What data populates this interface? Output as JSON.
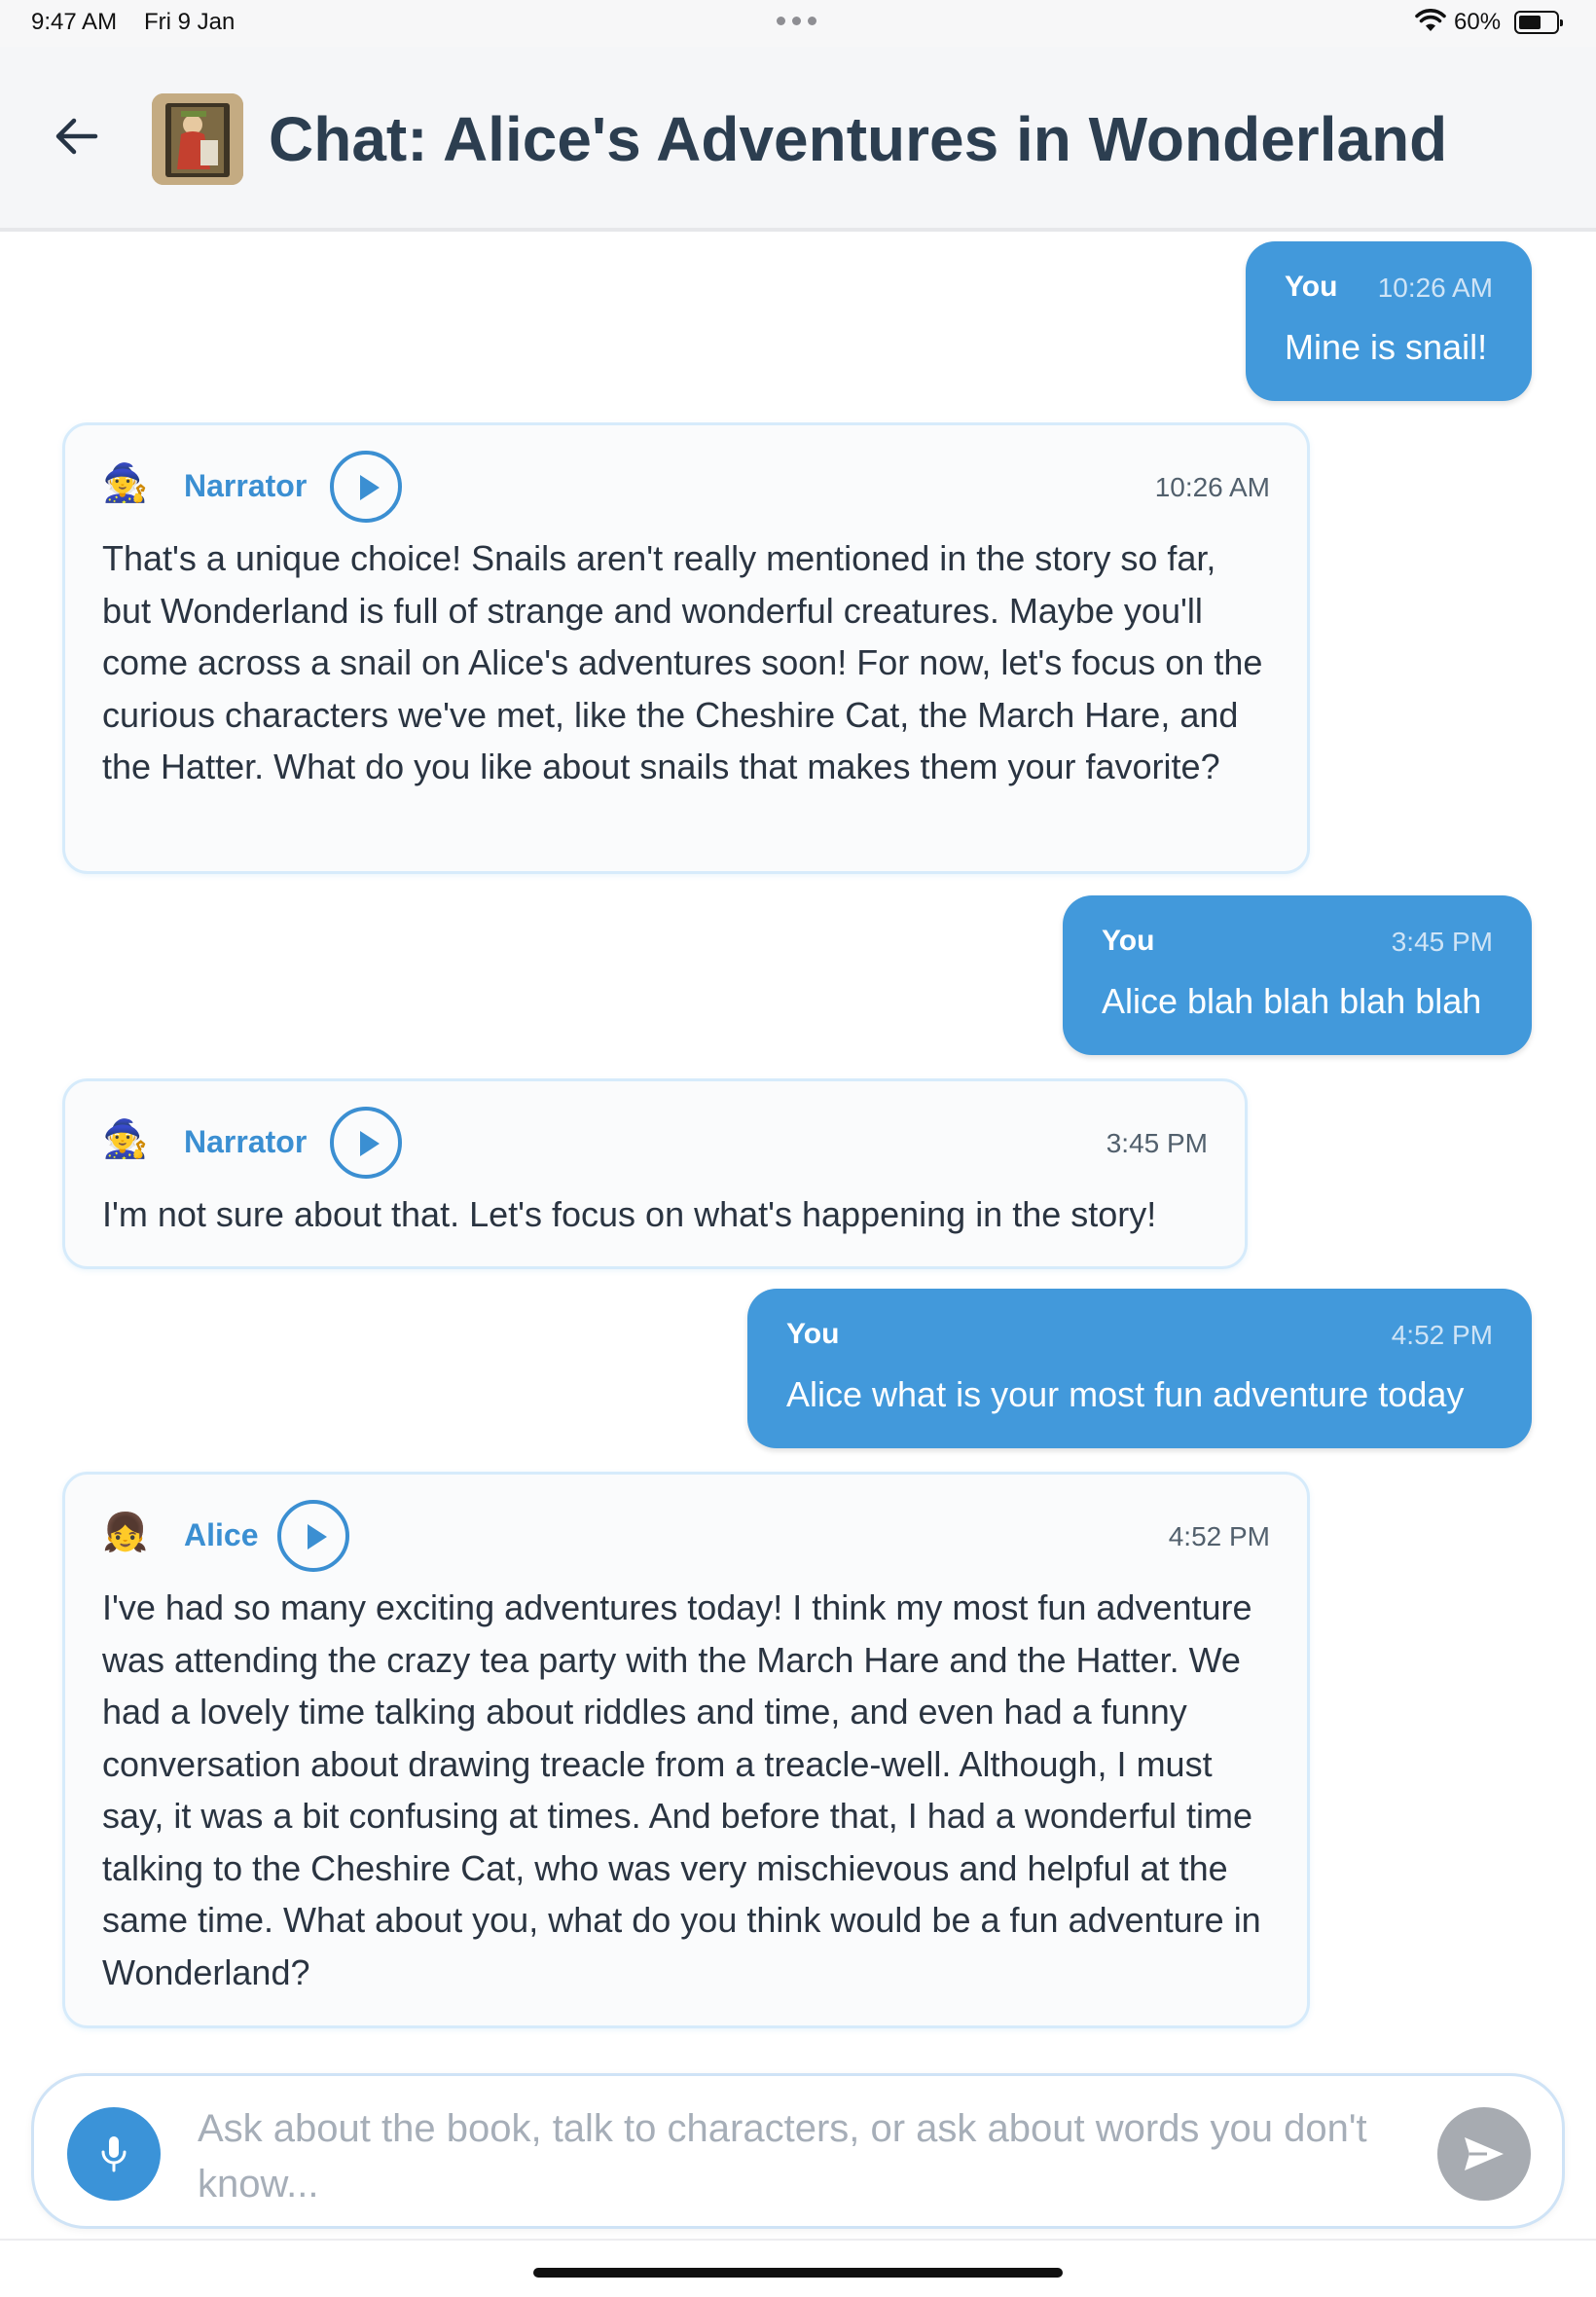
{
  "status_bar": {
    "time": "9:47 AM",
    "date": "Fri 9 Jan",
    "battery_percent": "60%",
    "battery_level": 0.6
  },
  "header": {
    "title": "Chat: Alice's Adventures in Wonderland",
    "back_icon": "arrow-left-icon",
    "cover_icon": "book-cover-thumbnail"
  },
  "messages": [
    {
      "role": "user",
      "sender": "You",
      "time": "10:26 AM",
      "text": "Mine is snail!"
    },
    {
      "role": "bot",
      "sender": "Narrator",
      "avatar": "🧙",
      "time": "10:26 AM",
      "text": "That's a unique choice! Snails aren't really mentioned in the story so far, but Wonderland is full of strange and wonderful creatures. Maybe you'll come across a snail on Alice's adventures soon! For now, let's focus on the curious characters we've met, like the Cheshire Cat, the March Hare, and the Hatter. What do you like about snails that makes them your favorite?"
    },
    {
      "role": "user",
      "sender": "You",
      "time": "3:45 PM",
      "text": "Alice blah blah blah blah"
    },
    {
      "role": "bot",
      "sender": "Narrator",
      "avatar": "🧙",
      "time": "3:45 PM",
      "text": "I'm not sure about that. Let's focus on what's happening in the story!"
    },
    {
      "role": "user",
      "sender": "You",
      "time": "4:52 PM",
      "text": "Alice what is your most fun adventure today"
    },
    {
      "role": "bot",
      "sender": "Alice",
      "avatar": "👧",
      "time": "4:52 PM",
      "text": "I've had so many exciting adventures today! I think my most fun adventure was attending the crazy tea party with the March Hare and the Hatter. We had a lovely time talking about riddles and time, and even had a funny conversation about drawing treacle from a treacle-well. Although, I must say, it was a bit confusing at times. And before that, I had a wonderful time talking to the Cheshire Cat, who was very mischievous and helpful at the same time. What about you, what do you think would be a fun adventure in Wonderland?"
    }
  ],
  "input": {
    "placeholder": "Ask about the book, talk to characters, or ask about words you don't know...",
    "value": "",
    "mic_icon": "microphone-icon",
    "send_icon": "send-icon"
  },
  "colors": {
    "accent": "#4299db",
    "bot_border": "#d6ebfb",
    "send_disabled": "#a7abb1",
    "title": "#2c3e50"
  }
}
